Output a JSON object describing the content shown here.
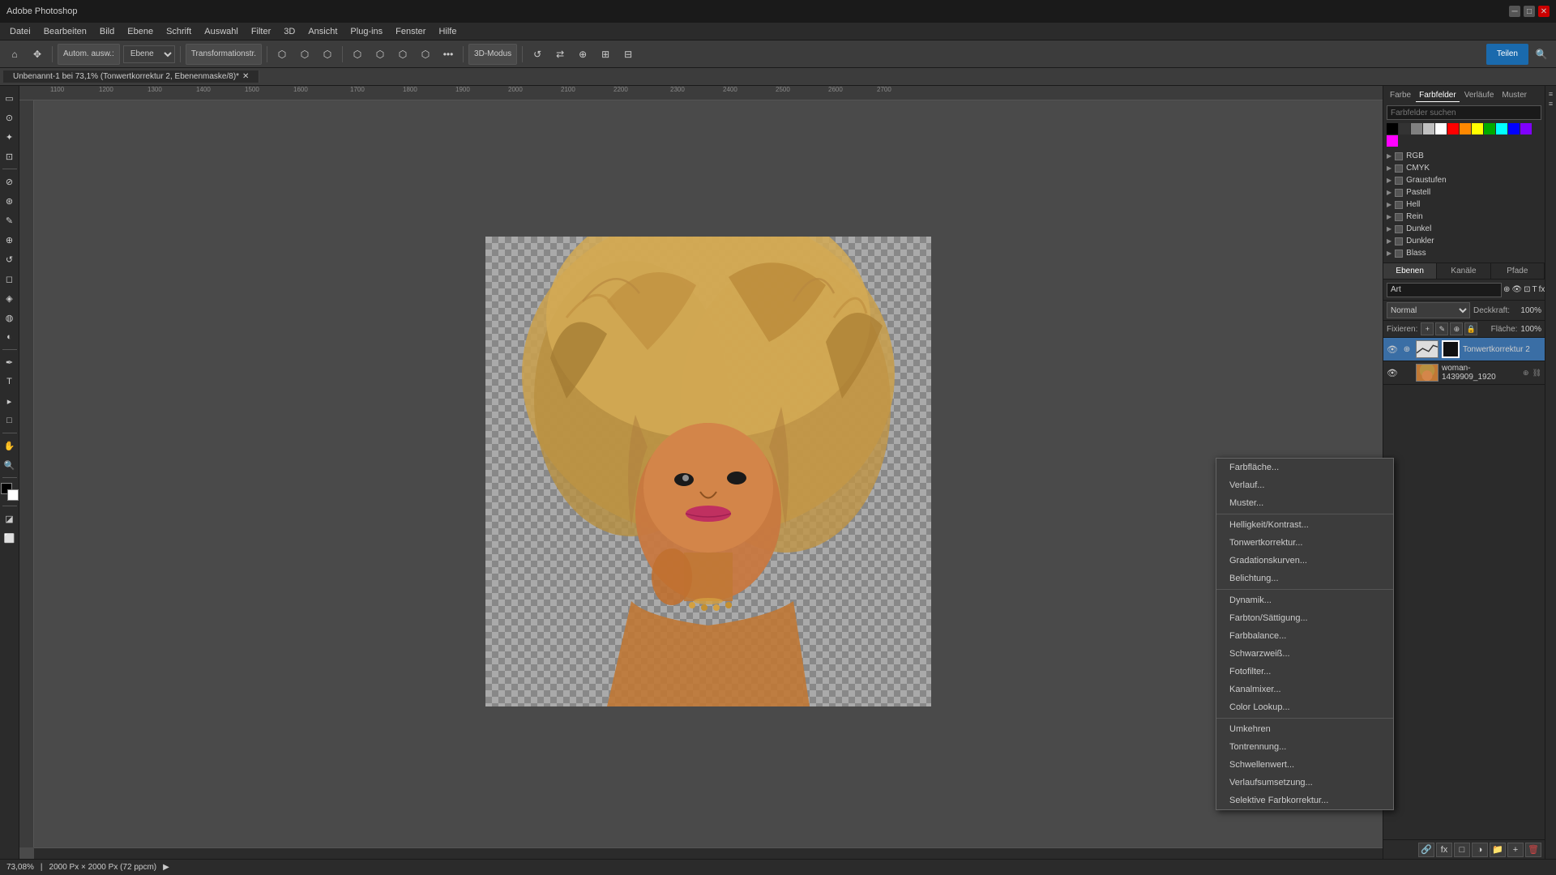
{
  "titlebar": {
    "title": "Adobe Photoshop",
    "win_min": "─",
    "win_max": "□",
    "win_close": "✕"
  },
  "menubar": {
    "items": [
      "Datei",
      "Bearbeiten",
      "Bild",
      "Ebene",
      "Schrift",
      "Auswahl",
      "Filter",
      "3D",
      "Ansicht",
      "Plug-ins",
      "Fenster",
      "Hilfe"
    ]
  },
  "toolbar": {
    "move_label": "▶",
    "autom_label": "Autom. ausw.:",
    "layer_label": "Ebene",
    "transform_label": "Transformationstr.",
    "mode_label": "3D-Modus",
    "share_label": "Teilen"
  },
  "tabbar": {
    "tab1": "Unbenannt-1 bei 73,1% (Tonwertkorrektur 2, Ebenenmaske/8)*",
    "tab_close": "✕"
  },
  "canvas": {
    "image_title": "woman-1439909_1920",
    "ruler_numbers": [
      "1100",
      "1200",
      "1300",
      "1400",
      "1500",
      "1600",
      "1700",
      "1800",
      "1900",
      "2000",
      "2100",
      "2200",
      "2300",
      "2400",
      "2500",
      "2600",
      "2700"
    ]
  },
  "statusbar": {
    "zoom": "73,08%",
    "dimensions": "2000 Px × 2000 Px (72 ppcm)",
    "arrow": "▶"
  },
  "color_panel": {
    "tabs": [
      "Farbe",
      "Farbfelder",
      "Verläufe",
      "Muster"
    ],
    "active_tab": "Farbfelder",
    "search_placeholder": "Farbfelder suchen",
    "swatches": [
      {
        "label": "Schwarz",
        "class": "swatch-black"
      },
      {
        "label": "DkGray",
        "class": "swatch-dk-gray"
      },
      {
        "label": "Gray",
        "class": "swatch-gray"
      },
      {
        "label": "LtGray",
        "class": "swatch-lt-gray"
      },
      {
        "label": "Weiß",
        "class": "swatch-white"
      },
      {
        "label": "Rot",
        "class": "swatch-red"
      },
      {
        "label": "Orange",
        "class": "swatch-orange"
      },
      {
        "label": "Gelb",
        "class": "swatch-yellow"
      },
      {
        "label": "Grün",
        "class": "swatch-green"
      },
      {
        "label": "Cyan",
        "class": "swatch-cyan"
      },
      {
        "label": "Blau",
        "class": "swatch-blue"
      },
      {
        "label": "Lila",
        "class": "swatch-purple"
      },
      {
        "label": "Magenta",
        "class": "swatch-magenta"
      }
    ],
    "groups": [
      "RGB",
      "CMYK",
      "Graustufen",
      "Pastell",
      "Hell",
      "Rein",
      "Dunkel",
      "Dunkler",
      "Blass"
    ]
  },
  "layers_panel": {
    "tabs": [
      "Ebenen",
      "Kanäle",
      "Pfade"
    ],
    "active_tab": "Ebenen",
    "search_placeholder": "Art",
    "blend_mode": "Normal",
    "opacity_label": "Deckkraft:",
    "opacity_value": "100%",
    "fix_label": "Fixieren:",
    "fill_label": "Fläche:",
    "fill_value": "100%",
    "layers": [
      {
        "name": "Tonwertkorrektur 2",
        "has_mask": true,
        "visible": true,
        "selected": true
      },
      {
        "name": "woman-1439909_1920",
        "has_mask": false,
        "visible": true,
        "selected": false
      }
    ]
  },
  "context_menu": {
    "items": [
      {
        "label": "Farbfläche...",
        "type": "item"
      },
      {
        "label": "Verlauf...",
        "type": "item"
      },
      {
        "label": "Muster...",
        "type": "item"
      },
      {
        "label": "",
        "type": "sep"
      },
      {
        "label": "Helligkeit/Kontrast...",
        "type": "item"
      },
      {
        "label": "Tonwertkorrektur...",
        "type": "item"
      },
      {
        "label": "Gradationskurven...",
        "type": "item"
      },
      {
        "label": "Belichtung...",
        "type": "item"
      },
      {
        "label": "",
        "type": "sep"
      },
      {
        "label": "Dynamik...",
        "type": "item"
      },
      {
        "label": "Farbton/Sättigung...",
        "type": "item"
      },
      {
        "label": "Farbbalance...",
        "type": "item"
      },
      {
        "label": "Schwarzweiß...",
        "type": "item"
      },
      {
        "label": "Fotofilter...",
        "type": "item"
      },
      {
        "label": "Kanalmixer...",
        "type": "item"
      },
      {
        "label": "Color Lookup...",
        "type": "item"
      },
      {
        "label": "",
        "type": "sep"
      },
      {
        "label": "Umkehren",
        "type": "item"
      },
      {
        "label": "Tontrennung...",
        "type": "item"
      },
      {
        "label": "Schwellenwert...",
        "type": "item"
      },
      {
        "label": "Verlaufsumsetzung...",
        "type": "item"
      },
      {
        "label": "Selektive Farbkorrektur...",
        "type": "item"
      }
    ]
  }
}
